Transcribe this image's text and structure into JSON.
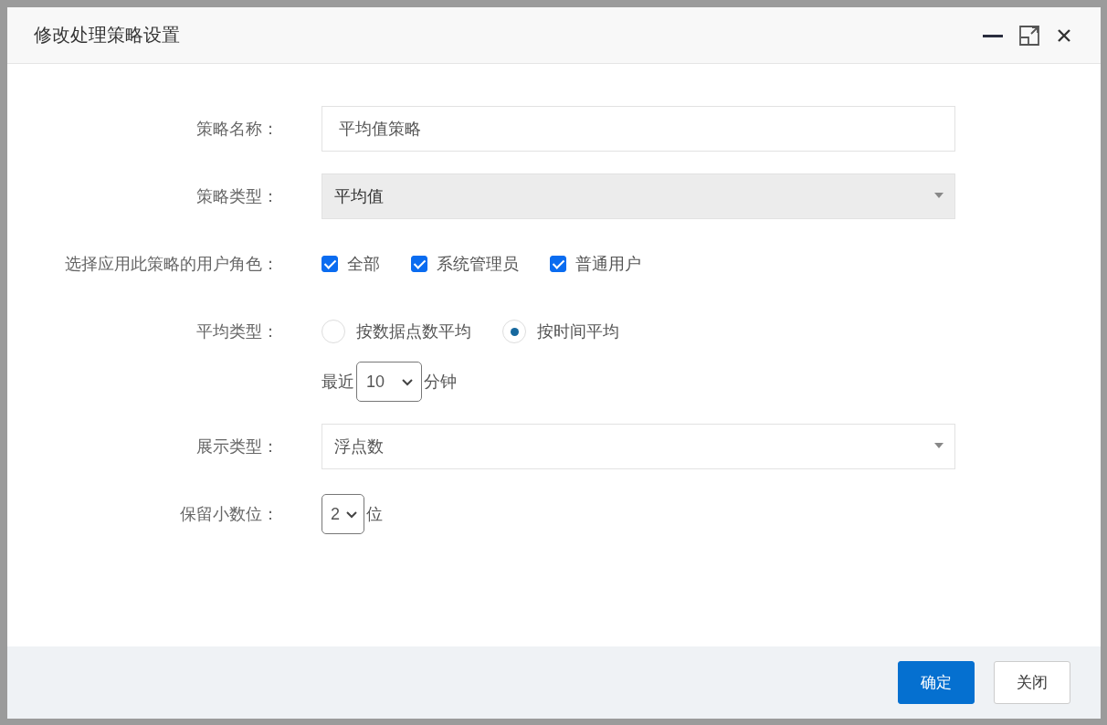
{
  "dialog": {
    "title": "修改处理策略设置"
  },
  "form": {
    "rows": [
      {
        "kind": "text",
        "label": "策略名称：",
        "value": "平均值策略"
      },
      {
        "kind": "select",
        "label": "策略类型：",
        "value": "平均值",
        "disabled": true
      },
      {
        "kind": "checkboxes",
        "label": "选择应用此策略的用户角色：",
        "options": [
          {
            "label": "全部",
            "checked": true
          },
          {
            "label": "系统管理员",
            "checked": true
          },
          {
            "label": "普通用户",
            "checked": true
          }
        ]
      },
      {
        "kind": "radios",
        "label": "平均类型：",
        "options": [
          {
            "label": "按数据点数平均",
            "selected": false
          },
          {
            "label": "按时间平均",
            "selected": true
          }
        ],
        "period": {
          "prefix": "最近",
          "value": "10",
          "suffix": "分钟"
        }
      },
      {
        "kind": "select",
        "label": "展示类型：",
        "value": "浮点数",
        "disabled": false
      },
      {
        "kind": "small_select",
        "label": "保留小数位：",
        "value": "2",
        "suffix": "位"
      }
    ]
  },
  "buttons": [
    {
      "label": "确定",
      "kind": "primary"
    },
    {
      "label": "关闭",
      "kind": "default"
    }
  ]
}
